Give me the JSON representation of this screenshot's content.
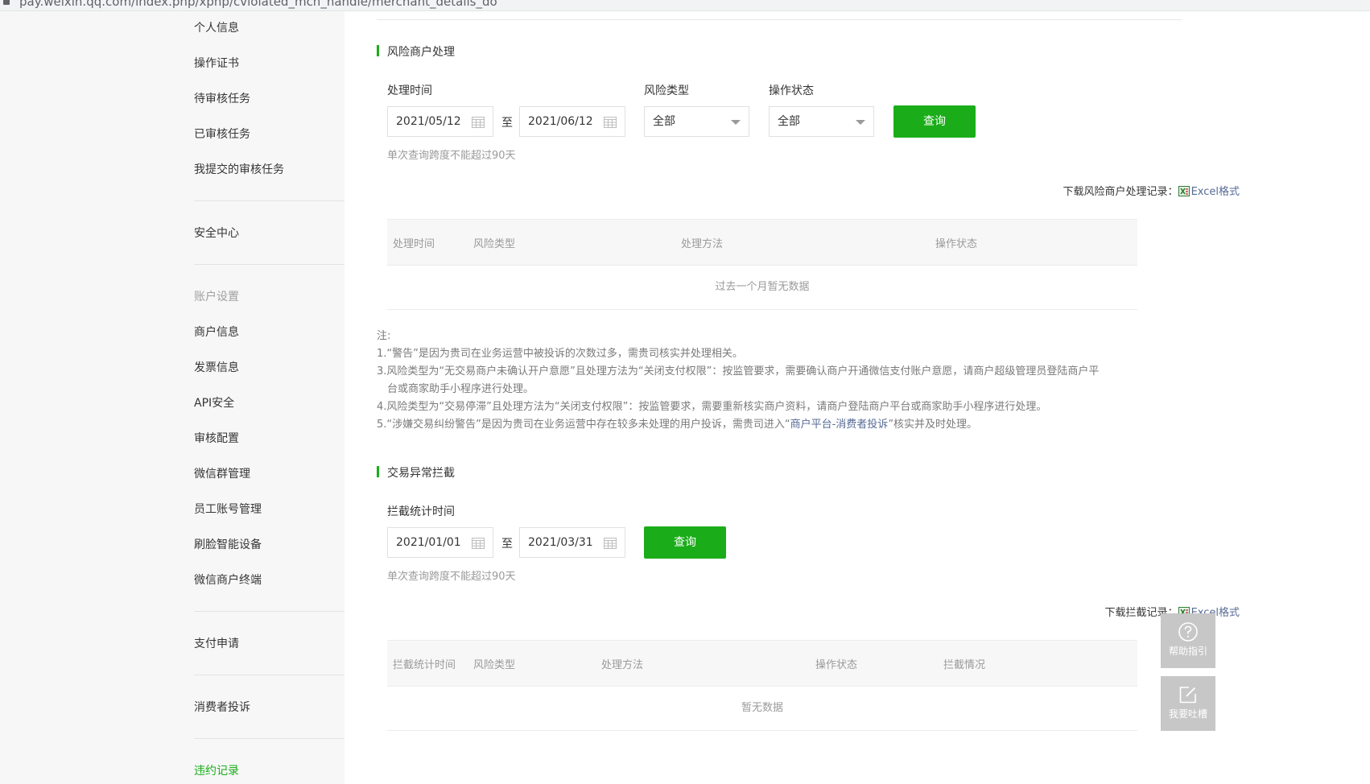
{
  "browser": {
    "url": "pay.weixin.qq.com/index.php/xphp/cviolated_mch_handle/merchant_details_do"
  },
  "sidebar": {
    "items_top": [
      "个人信息",
      "操作证书",
      "待审核任务",
      "已审核任务",
      "我提交的审核任务"
    ],
    "security": "安全中心",
    "account_group": "账户设置",
    "account_items": [
      "商户信息",
      "发票信息",
      "API安全",
      "审核配置",
      "微信群管理",
      "员工账号管理",
      "刷脸智能设备",
      "微信商户终端"
    ],
    "pay_apply": "支付申请",
    "complaints": "消费者投诉",
    "violations": "违约记录"
  },
  "risk": {
    "title": "风险商户处理",
    "time_label": "处理时间",
    "start_date": "2021/05/12",
    "to": "至",
    "end_date": "2021/06/12",
    "type_label": "风险类型",
    "type_value": "全部",
    "status_label": "操作状态",
    "status_value": "全部",
    "query": "查询",
    "hint": "单次查询跨度不能超过90天",
    "download_prefix": "下载风险商户处理记录：",
    "download_link": "Excel格式",
    "columns": [
      "处理时间",
      "风险类型",
      "处理方法",
      "操作状态"
    ],
    "empty": "过去一个月暂无数据"
  },
  "notes": {
    "title": "注:",
    "n1": "1.“警告”是因为贵司在业务运营中被投诉的次数过多，需贵司核实并处理相关。",
    "n3a": "3.风险类型为“无交易商户未确认开户意愿”且处理方法为“关闭支付权限”：按监管要求，需要确认商户开通微信支付账户意愿，请商户超级管理员登陆商户平",
    "n3b": "台或商家助手小程序进行处理。",
    "n4": "4.风险类型为“交易停滞”且处理方法为“关闭支付权限”：按监管要求，需要重新核实商户资料，请商户登陆商户平台或商家助手小程序进行处理。",
    "n5_pre": "5.“涉嫌交易纠纷警告”是因为贵司在业务运营中存在较多未处理的用户投诉，需贵司进入“",
    "n5_link": "商户平台-消费者投诉",
    "n5_post": "”核实并及时处理。"
  },
  "intercept": {
    "title": "交易异常拦截",
    "time_label": "拦截统计时间",
    "start_date": "2021/01/01",
    "to": "至",
    "end_date": "2021/03/31",
    "query": "查询",
    "hint": "单次查询跨度不能超过90天",
    "download_prefix": "下载拦截记录：",
    "download_link": "Excel格式",
    "columns": [
      "拦截统计时间",
      "风险类型",
      "处理方法",
      "操作状态",
      "拦截情况"
    ],
    "empty": "暂无数据"
  },
  "floating": {
    "help": "帮助指引",
    "feedback": "我要吐槽"
  },
  "colors": {
    "accent": "#1aad19",
    "link": "#576b95",
    "sidebar_bg": "#f7f7f7"
  }
}
